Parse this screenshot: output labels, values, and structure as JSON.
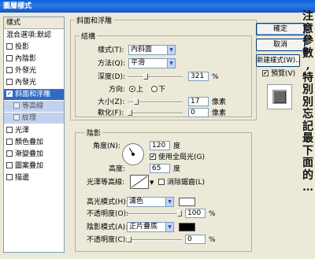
{
  "window": {
    "title": "圖層樣式"
  },
  "sidebar": {
    "header": "樣式",
    "items": [
      {
        "label": "混合選項:默認",
        "checkbox": false,
        "state": "normal"
      },
      {
        "label": "投影",
        "checkbox": true,
        "checked": false,
        "state": "normal"
      },
      {
        "label": "內陰影",
        "checkbox": true,
        "checked": false,
        "state": "normal"
      },
      {
        "label": "外發光",
        "checkbox": true,
        "checked": false,
        "state": "normal"
      },
      {
        "label": "內發光",
        "checkbox": true,
        "checked": false,
        "state": "normal"
      },
      {
        "label": "斜面和浮雕",
        "checkbox": true,
        "checked": true,
        "state": "selected"
      },
      {
        "label": "等高線",
        "checkbox": true,
        "checked": false,
        "state": "sub"
      },
      {
        "label": "紋理",
        "checkbox": true,
        "checked": false,
        "state": "sub"
      },
      {
        "label": "光澤",
        "checkbox": true,
        "checked": false,
        "state": "normal"
      },
      {
        "label": "顏色疊加",
        "checkbox": true,
        "checked": false,
        "state": "normal"
      },
      {
        "label": "漸變疊加",
        "checkbox": true,
        "checked": false,
        "state": "normal"
      },
      {
        "label": "圖案疊加",
        "checkbox": true,
        "checked": false,
        "state": "normal"
      },
      {
        "label": "描邊",
        "checkbox": true,
        "checked": false,
        "state": "normal"
      }
    ]
  },
  "bevel": {
    "group_label": "斜面和浮雕",
    "structure_label": "結構",
    "style_label": "樣式(T):",
    "style_value": "內斜面",
    "technique_label": "方法(Q):",
    "technique_value": "平滑",
    "depth_label": "深度(D):",
    "depth_value": "321",
    "depth_unit": "%",
    "depth_percent": 32,
    "direction_label": "方向:",
    "dir_up": "上",
    "dir_down": "下",
    "size_label": "大小(Z):",
    "size_value": "17",
    "size_unit": "像素",
    "soften_label": "軟化(F):",
    "soften_value": "0",
    "soften_unit": "像素"
  },
  "shading": {
    "group_label": "陰影",
    "angle_label": "角度(N):",
    "angle_value": "120",
    "angle_unit": "度",
    "global_light_label": "使用全局光(G)",
    "altitude_label": "高度:",
    "altitude_value": "65",
    "altitude_unit": "度",
    "gloss_label": "光澤等高線:",
    "antialias_label": "消除鋸齒(L)",
    "highlight_mode_label": "高光模式(H):",
    "highlight_mode_value": "濾色",
    "highlight_color": "#ffffff",
    "highlight_opacity_label": "不透明度(O):",
    "highlight_opacity_value": "100",
    "highlight_opacity_unit": "%",
    "shadow_mode_label": "陰影模式(A):",
    "shadow_mode_value": "正片疊底",
    "shadow_color": "#000000",
    "shadow_opacity_label": "不透明度(C):",
    "shadow_opacity_value": "0",
    "shadow_opacity_unit": "%"
  },
  "buttons": {
    "ok": "確定",
    "cancel": "取消",
    "new_style": "新建樣式(W)...",
    "preview": "預覽(V)"
  },
  "annotation": {
    "chars": [
      "注",
      "意",
      "參",
      "數",
      ",",
      "特",
      "別",
      "別",
      "忘",
      "記",
      "最",
      "下",
      "面",
      "的",
      "…"
    ]
  },
  "colors": {
    "selection": "#316ac5",
    "title_bar": "#0a5fd8",
    "dialog_bg": "#ece9d8"
  }
}
